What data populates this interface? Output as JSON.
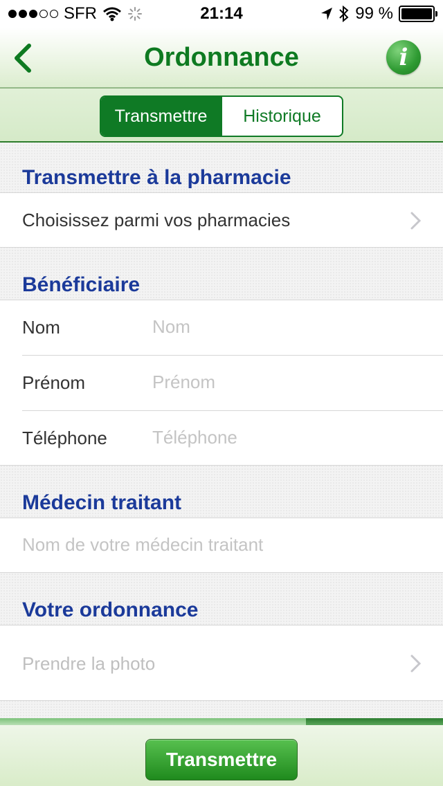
{
  "status_bar": {
    "carrier": "SFR",
    "time": "21:14",
    "battery": "99 %",
    "battery_level": 0.99
  },
  "nav": {
    "title": "Ordonnance",
    "info_glyph": "i"
  },
  "tabs": [
    {
      "label": "Transmettre",
      "active": true
    },
    {
      "label": "Historique",
      "active": false
    }
  ],
  "sections": {
    "pharmacy": {
      "title": "Transmettre à la pharmacie",
      "choice": "Choisissez parmi vos pharmacies"
    },
    "beneficiary": {
      "title": "Bénéficiaire",
      "fields": [
        {
          "label": "Nom",
          "placeholder": "Nom",
          "value": ""
        },
        {
          "label": "Prénom",
          "placeholder": "Prénom",
          "value": ""
        },
        {
          "label": "Téléphone",
          "placeholder": "Téléphone",
          "value": ""
        }
      ]
    },
    "doctor": {
      "title": "Médecin traitant",
      "placeholder": "Nom de votre médecin traitant"
    },
    "prescription": {
      "title": "Votre ordonnance",
      "photo": "Prendre la photo"
    }
  },
  "scroll_progress": 0.69,
  "submit_label": "Transmettre",
  "colors": {
    "brand_green": "#0f7a25",
    "header_blue": "#1b3a9a"
  }
}
